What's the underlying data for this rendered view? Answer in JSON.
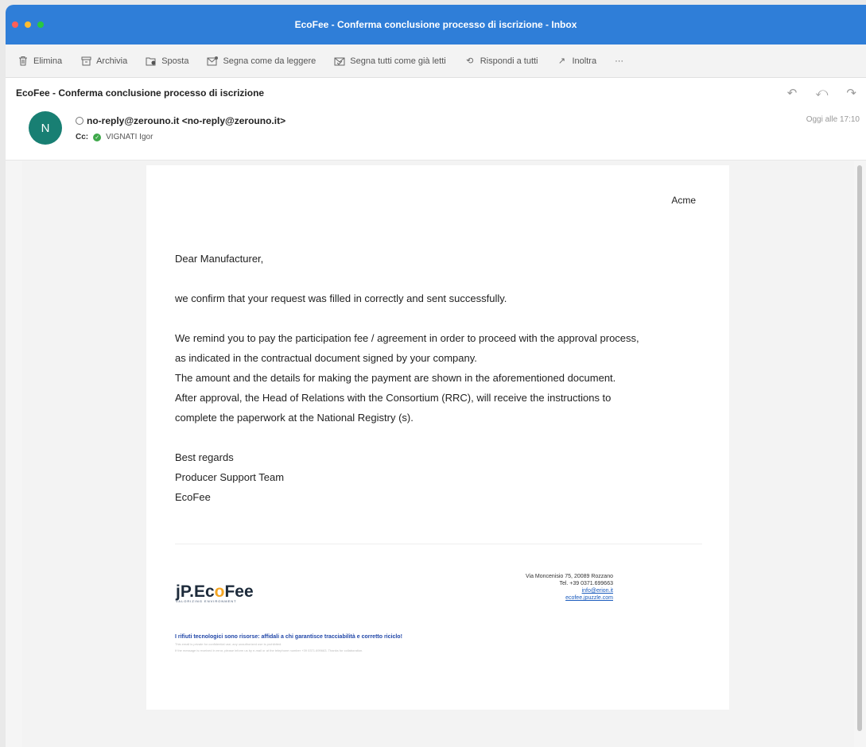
{
  "window": {
    "title": "EcoFee - Conferma conclusione processo di iscrizione - Inbox"
  },
  "toolbar": {
    "items": [
      {
        "label": "Elimina",
        "icon": "trash-icon"
      },
      {
        "label": "Archivia",
        "icon": "archive-icon"
      },
      {
        "label": "Sposta",
        "icon": "move-icon"
      },
      {
        "label": "Segna come da leggere",
        "icon": "mail-unread-icon"
      },
      {
        "label": "Segna tutti come già letti",
        "icon": "mail-read-icon"
      },
      {
        "label": "Rispondi a tutti",
        "icon": "reply-all-icon"
      },
      {
        "label": "Inoltra",
        "icon": "forward-icon"
      },
      {
        "label": "···",
        "icon": "more-icon"
      }
    ]
  },
  "message": {
    "subject": "EcoFee - Conferma conclusione processo di iscrizione",
    "avatar_initial": "N",
    "sender": "no-reply@zerouno.it <no-reply@zerouno.it>",
    "cc_label": "Cc:",
    "cc_name": "VIGNATI Igor",
    "date": "Oggi alle 17:10"
  },
  "content": {
    "company": "Acme",
    "greeting": "Dear Manufacturer,",
    "p1": "we confirm that your request was filled in correctly and sent successfully.",
    "p2_lines": [
      "We remind you to pay the participation fee / agreement in order to proceed with the approval process,",
      "as indicated in the contractual document signed by your company.",
      "The amount and the details for making the payment are shown in the aforementioned document.",
      "After approval, the Head of Relations with the Consortium (RRC), will receive the instructions to",
      "complete the paperwork at the National Registry (s)."
    ],
    "closing": [
      "Best regards",
      "Producer Support Team",
      "EcoFee"
    ]
  },
  "footer": {
    "logo_main_a": "jP.Ec",
    "logo_main_b": "o",
    "logo_main_c": "Fee",
    "logo_sub": "VALORIZING ENVIRONMENT",
    "address": "Via Moncenisio 75, 20089 Rozzano",
    "tel": "Tel. +39 0371.699663",
    "email": "info@erion.it",
    "web": "ecofee.jpuzzle.com",
    "slogan": "I rifiuti tecnologici sono risorse: affidali a chi garantisce tracciabilità e corretto riciclo!",
    "disclaimer_1": "This email is private for confidential use; any unauthorized use is prohibited.",
    "disclaimer_2": "If the message is received in error, please inform us by e-mail or at the telephone number +39 0371.699663. Thanks for collaboration."
  },
  "colors": {
    "titlebar": "#2f7ed8",
    "avatar": "#187f73",
    "check": "#3ea84a"
  }
}
